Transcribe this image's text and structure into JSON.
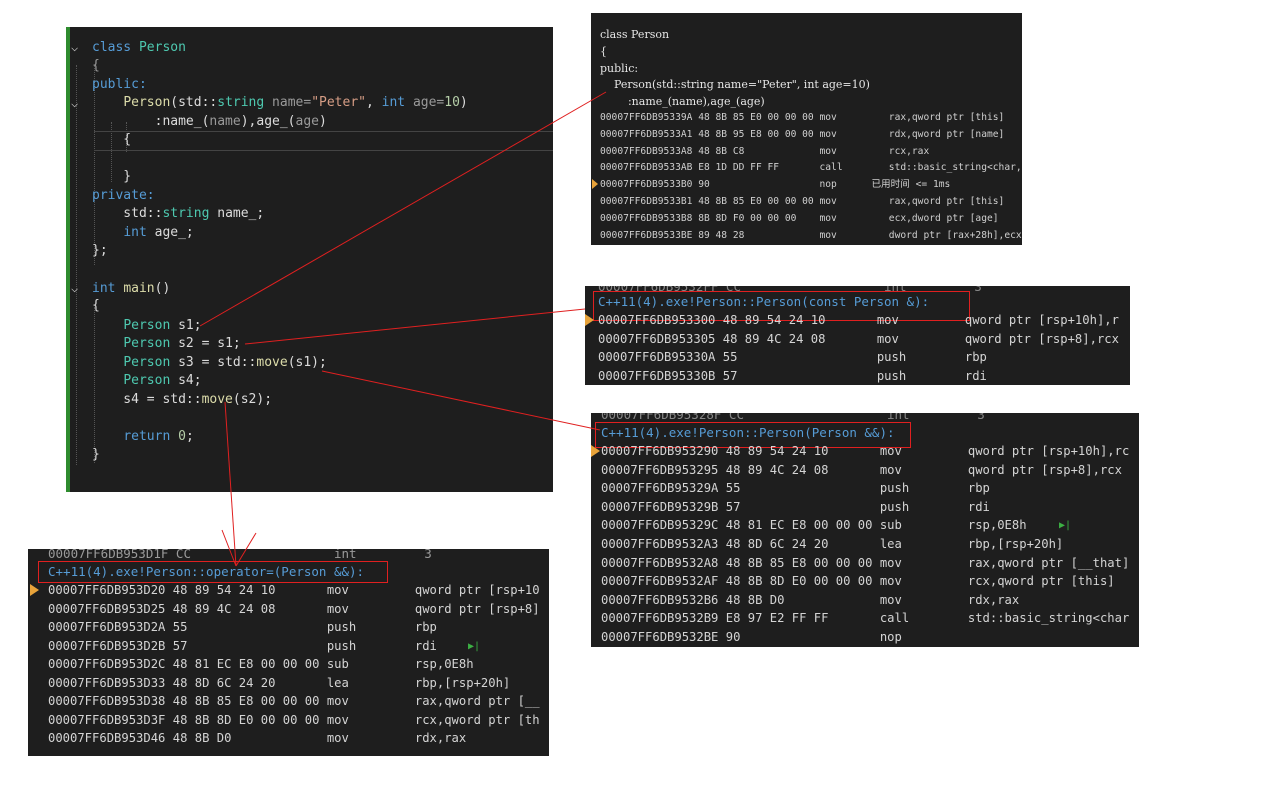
{
  "code_panel": {
    "lines": [
      [
        {
          "t": "class ",
          "c": "kw"
        },
        {
          "t": "Person",
          "c": "ty"
        }
      ],
      [
        {
          "t": "{",
          "c": "gray"
        }
      ],
      [
        {
          "t": "public:",
          "c": "kw"
        }
      ],
      [
        {
          "t": "    ",
          "c": "pl"
        },
        {
          "t": "Person",
          "c": "fn"
        },
        {
          "t": "(",
          "c": "pl"
        },
        {
          "t": "std",
          "c": "pl"
        },
        {
          "t": "::",
          "c": "pl"
        },
        {
          "t": "string",
          "c": "ty"
        },
        {
          "t": " name=",
          "c": "gray"
        },
        {
          "t": "\"Peter\"",
          "c": "str"
        },
        {
          "t": ", ",
          "c": "pl"
        },
        {
          "t": "int",
          "c": "kw"
        },
        {
          "t": " age=",
          "c": "gray"
        },
        {
          "t": "10",
          "c": "num"
        },
        {
          "t": ")",
          "c": "pl"
        }
      ],
      [
        {
          "t": "        :name_(",
          "c": "pl"
        },
        {
          "t": "name",
          "c": "gray"
        },
        {
          "t": "),age_(",
          "c": "pl"
        },
        {
          "t": "age",
          "c": "gray"
        },
        {
          "t": ")",
          "c": "pl"
        }
      ],
      [
        {
          "t": "    {",
          "c": "pl"
        }
      ],
      [
        {
          "t": "",
          "c": "pl"
        }
      ],
      [
        {
          "t": "    }",
          "c": "pl"
        }
      ],
      [
        {
          "t": "private:",
          "c": "kw"
        }
      ],
      [
        {
          "t": "    std::",
          "c": "pl"
        },
        {
          "t": "string",
          "c": "ty"
        },
        {
          "t": " name_;",
          "c": "pl"
        }
      ],
      [
        {
          "t": "    ",
          "c": "pl"
        },
        {
          "t": "int",
          "c": "kw"
        },
        {
          "t": " age_;",
          "c": "pl"
        }
      ],
      [
        {
          "t": "};",
          "c": "pl"
        }
      ],
      [
        {
          "t": "",
          "c": "pl"
        }
      ],
      [
        {
          "t": "int",
          "c": "kw"
        },
        {
          "t": " ",
          "c": "pl"
        },
        {
          "t": "main",
          "c": "fn"
        },
        {
          "t": "()",
          "c": "pl"
        }
      ],
      [
        {
          "t": "{",
          "c": "pl"
        }
      ],
      [
        {
          "t": "    ",
          "c": "pl"
        },
        {
          "t": "Person",
          "c": "ty"
        },
        {
          "t": " s1;",
          "c": "pl"
        }
      ],
      [
        {
          "t": "    ",
          "c": "pl"
        },
        {
          "t": "Person",
          "c": "ty"
        },
        {
          "t": " s2 = s1;",
          "c": "pl"
        }
      ],
      [
        {
          "t": "    ",
          "c": "pl"
        },
        {
          "t": "Person",
          "c": "ty"
        },
        {
          "t": " s3 = std::",
          "c": "pl"
        },
        {
          "t": "move",
          "c": "fn"
        },
        {
          "t": "(s1);",
          "c": "pl"
        }
      ],
      [
        {
          "t": "    ",
          "c": "pl"
        },
        {
          "t": "Person",
          "c": "ty"
        },
        {
          "t": " s4;",
          "c": "pl"
        }
      ],
      [
        {
          "t": "    s4 = std::",
          "c": "pl"
        },
        {
          "t": "move",
          "c": "fn"
        },
        {
          "t": "(s2);",
          "c": "pl"
        }
      ],
      [
        {
          "t": "",
          "c": "pl"
        }
      ],
      [
        {
          "t": "    ",
          "c": "pl"
        },
        {
          "t": "return",
          "c": "kw"
        },
        {
          "t": " ",
          "c": "pl"
        },
        {
          "t": "0",
          "c": "num"
        },
        {
          "t": ";",
          "c": "pl"
        }
      ],
      [
        {
          "t": "}",
          "c": "pl"
        }
      ]
    ]
  },
  "asm_ctor_default": {
    "source": [
      "class Person",
      "{",
      "public:",
      "    Person(std::string name=\"Peter\", int age=10)",
      "        :name_(name),age_(age)"
    ],
    "rows": [
      "00007FF6DB95339A 48 8B 85 E0 00 00 00 mov         rax,qword ptr [this]",
      "00007FF6DB9533A1 48 8B 95 E8 00 00 00 mov         rdx,qword ptr [name]",
      "00007FF6DB9533A8 48 8B C8             mov         rcx,rax",
      "00007FF6DB9533AB E8 1D DD FF FF       call        std::basic_string<char,std::",
      "00007FF6DB9533B0 90                   nop      已用时间 <= 1ms",
      "00007FF6DB9533B1 48 8B 85 E0 00 00 00 mov         rax,qword ptr [this]",
      "00007FF6DB9533B8 8B 8D F0 00 00 00    mov         ecx,dword ptr [age]",
      "00007FF6DB9533BE 89 48 28             mov         dword ptr [rax+28h],ecx"
    ]
  },
  "asm_copy_ctor": {
    "header": "C++11(4).exe!Person::Person(const Person &):",
    "rows": [
      "00007FF6DB953300 48 89 54 24 10       mov         qword ptr [rsp+10h],r",
      "00007FF6DB953305 48 89 4C 24 08       mov         qword ptr [rsp+8],rcx",
      "00007FF6DB95330A 55                   push        rbp",
      "00007FF6DB95330B 57                   push        rdi"
    ]
  },
  "asm_move_ctor": {
    "header": "C++11(4).exe!Person::Person(Person &&):",
    "rows": [
      "00007FF6DB953290 48 89 54 24 10       mov         qword ptr [rsp+10h],rc",
      "00007FF6DB953295 48 89 4C 24 08       mov         qword ptr [rsp+8],rcx",
      "00007FF6DB95329A 55                   push        rbp",
      "00007FF6DB95329B 57                   push        rdi",
      "00007FF6DB95329C 48 81 EC E8 00 00 00 sub         rsp,0E8h",
      "00007FF6DB9532A3 48 8D 6C 24 20       lea         rbp,[rsp+20h]",
      "00007FF6DB9532A8 48 8B 85 E8 00 00 00 mov         rax,qword ptr [__that]",
      "00007FF6DB9532AF 48 8B 8D E0 00 00 00 mov         rcx,qword ptr [this]",
      "00007FF6DB9532B6 48 8B D0             mov         rdx,rax",
      "00007FF6DB9532B9 E8 97 E2 FF FF       call        std::basic_string<char",
      "00007FF6DB9532BE 90                   nop"
    ]
  },
  "asm_move_assign": {
    "top_row": "00007FF6DB953D1F CC                   int         3",
    "header": "C++11(4).exe!Person::operator=(Person &&):",
    "rows": [
      "00007FF6DB953D20 48 89 54 24 10       mov         qword ptr [rsp+10",
      "00007FF6DB953D25 48 89 4C 24 08       mov         qword ptr [rsp+8]",
      "00007FF6DB953D2A 55                   push        rbp",
      "00007FF6DB953D2B 57                   push        rdi",
      "00007FF6DB953D2C 48 81 EC E8 00 00 00 sub         rsp,0E8h",
      "00007FF6DB953D33 48 8D 6C 24 20       lea         rbp,[rsp+20h]",
      "00007FF6DB953D38 48 8B 85 E8 00 00 00 mov         rax,qword ptr [__",
      "00007FF6DB953D3F 48 8B 8D E0 00 00 00 mov         rcx,qword ptr [th",
      "00007FF6DB953D46 48 8B D0             mov         rdx,rax"
    ]
  }
}
